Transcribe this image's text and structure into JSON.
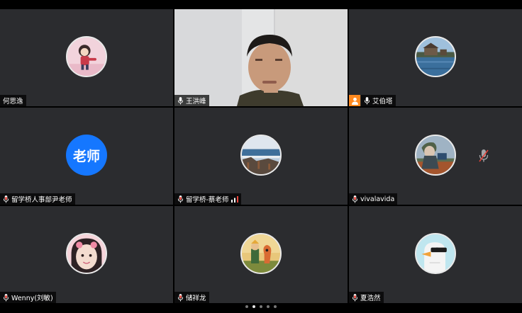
{
  "app": {
    "page_count": 5,
    "current_page": 2
  },
  "colors": {
    "tile_bg": "#2b2c2f",
    "active_border": "#28c46a",
    "host_badge": "#ff8a1f",
    "text_avatar_bg": "#1577ff",
    "mic_red": "#e8443a"
  },
  "participants": [
    {
      "name": "何思逸",
      "mic": "none",
      "avatar": "cartoon-girl"
    },
    {
      "name": "王洪峰",
      "mic": "on",
      "video": true,
      "active_speaker": true
    },
    {
      "name": "艾伯塔",
      "mic": "on",
      "host": true,
      "avatar": "lake-house"
    },
    {
      "name": "留学桥人事部尹老师",
      "mic": "muted",
      "avatar_text": "老师"
    },
    {
      "name": "留学桥-蔡老师",
      "mic": "muted",
      "signal": true,
      "avatar": "seaside"
    },
    {
      "name": "vivalavida",
      "mic": "muted",
      "avatar": "anime-character",
      "big_muted_icon": true
    },
    {
      "name": "Wenny(刘敏)",
      "mic": "muted",
      "avatar": "selfie-girl"
    },
    {
      "name": "储祥龙",
      "mic": "muted",
      "avatar": "little-prince"
    },
    {
      "name": "夏浩然",
      "mic": "muted",
      "avatar": "goose-sunglasses"
    }
  ]
}
